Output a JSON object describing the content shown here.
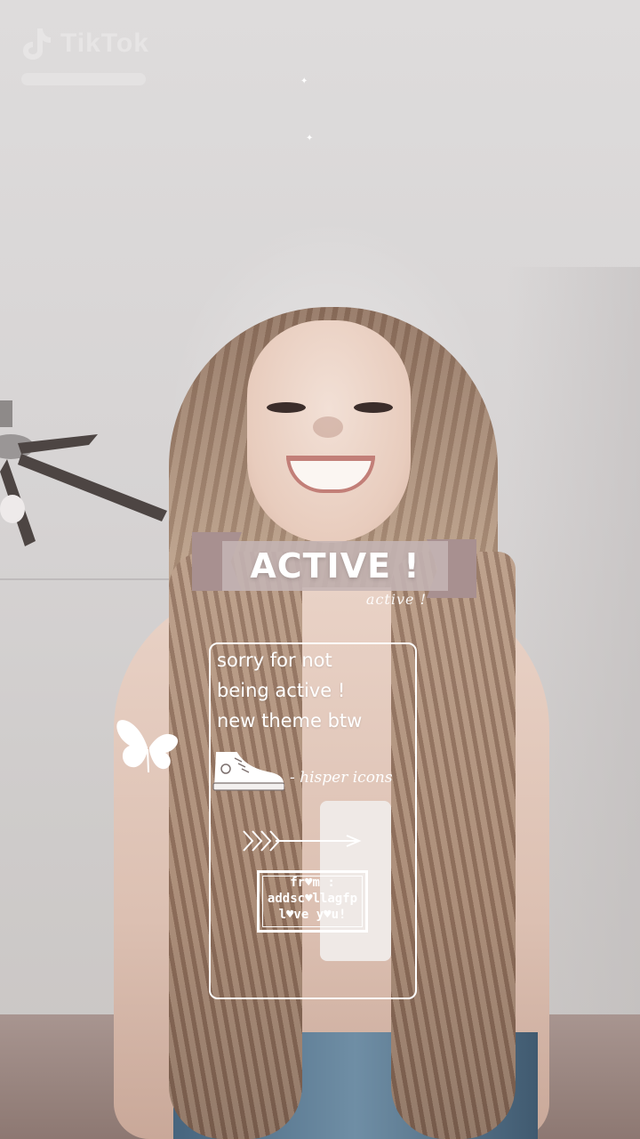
{
  "watermark": {
    "app_name": "TikTok",
    "icon": "tiktok-logo-icon"
  },
  "overlay": {
    "title": "ACTIVE !",
    "subtitle": "active !",
    "message_lines": [
      "sorry for not",
      "being active !",
      "new theme btw"
    ],
    "credit": "- hisper icons",
    "from_lines": [
      "fr♥m :",
      "addsc♥llagfp",
      "l♥ve y♥u!"
    ],
    "icons": [
      "butterfly-icon",
      "sneaker-icon",
      "arrow-icon",
      "tiktok-logo-icon"
    ]
  },
  "colors": {
    "banner": "#c4b4b4",
    "ribbon": "#a89090",
    "text": "#ffffff",
    "background": "#d9d6d6"
  }
}
